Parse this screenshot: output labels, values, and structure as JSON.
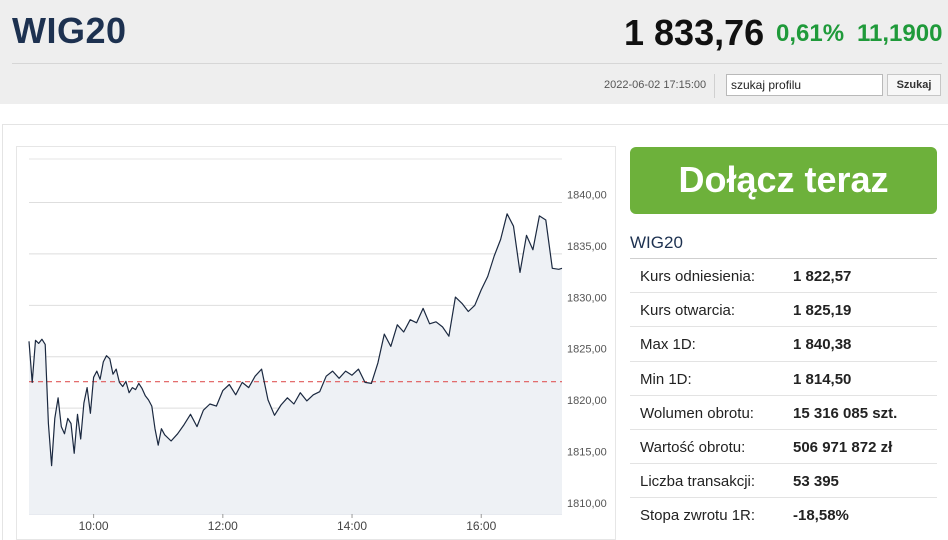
{
  "header": {
    "title": "WIG20",
    "price": "1 833,76",
    "change_pct": "0,61%",
    "change_abs": "11,1900",
    "timestamp": "2022-06-02 17:15:00",
    "search_placeholder": "szukaj profilu",
    "search_button": "Szukaj"
  },
  "colors": {
    "brand": "#1d3150",
    "positive": "#1f9a3a",
    "cta": "#6db13b",
    "line": "#1b2940",
    "reference": "#e05a5a"
  },
  "cta": {
    "label": "Dołącz teraz"
  },
  "panel": {
    "title": "WIG20",
    "rows": [
      {
        "label": "Kurs odniesienia:",
        "value": "1 822,57"
      },
      {
        "label": "Kurs otwarcia:",
        "value": "1 825,19"
      },
      {
        "label": "Max 1D:",
        "value": "1 840,38"
      },
      {
        "label": "Min 1D:",
        "value": "1 814,50"
      },
      {
        "label": "Wolumen obrotu:",
        "value": "15 316 085 szt."
      },
      {
        "label": "Wartość obrotu:",
        "value": "506 971 872 zł"
      },
      {
        "label": "Liczba transakcji:",
        "value": "53 395"
      },
      {
        "label": "Stopa zwrotu 1R:",
        "value": "-18,58%"
      }
    ]
  },
  "chart_data": {
    "type": "area",
    "title": "",
    "xlabel": "",
    "ylabel": "",
    "x_ticks": [
      "10:00",
      "12:00",
      "14:00",
      "16:00"
    ],
    "y_ticks": [
      "1810,00",
      "1815,00",
      "1820,00",
      "1825,00",
      "1830,00",
      "1835,00",
      "1840,00"
    ],
    "ylim": [
      1809.7,
      1845.4
    ],
    "xlim": [
      9.0,
      17.25
    ],
    "reference_value": 1822.57,
    "grid": true,
    "series": [
      {
        "x": [
          9.0,
          9.05,
          9.1,
          9.15,
          9.2,
          9.25,
          9.3,
          9.35,
          9.4,
          9.45,
          9.5,
          9.55,
          9.6,
          9.65,
          9.7,
          9.75,
          9.8,
          9.85,
          9.9,
          9.95,
          10.0,
          10.05,
          10.1,
          10.15,
          10.2,
          10.25,
          10.3,
          10.35,
          10.4,
          10.45,
          10.5,
          10.55,
          10.6,
          10.65,
          10.7,
          10.75,
          10.8,
          10.85,
          10.9,
          10.95,
          11.0,
          11.05,
          11.1,
          11.2,
          11.3,
          11.4,
          11.5,
          11.6,
          11.7,
          11.8,
          11.9,
          12.0,
          12.1,
          12.2,
          12.3,
          12.4,
          12.5,
          12.6,
          12.7,
          12.8,
          12.9,
          13.0,
          13.1,
          13.2,
          13.3,
          13.4,
          13.5,
          13.6,
          13.7,
          13.8,
          13.9,
          14.0,
          14.1,
          14.2,
          14.3,
          14.4,
          14.5,
          14.6,
          14.7,
          14.8,
          14.9,
          15.0,
          15.1,
          15.2,
          15.3,
          15.4,
          15.5,
          15.6,
          15.7,
          15.8,
          15.9,
          16.0,
          16.1,
          16.2,
          16.3,
          16.4,
          16.5,
          16.6,
          16.7,
          16.8,
          16.9,
          17.0,
          17.1,
          17.2,
          17.25
        ],
        "y": [
          1826.5,
          1822.5,
          1826.6,
          1826.3,
          1826.7,
          1826.2,
          1818.5,
          1814.4,
          1819.0,
          1821.0,
          1818.2,
          1817.5,
          1819.0,
          1818.5,
          1815.6,
          1819.4,
          1817.0,
          1820.5,
          1822.0,
          1819.5,
          1823.0,
          1823.6,
          1822.8,
          1824.5,
          1825.1,
          1824.8,
          1823.3,
          1823.8,
          1822.5,
          1822.1,
          1822.6,
          1821.5,
          1822.0,
          1821.8,
          1822.4,
          1821.9,
          1821.2,
          1820.8,
          1820.2,
          1818.0,
          1816.4,
          1818.0,
          1817.4,
          1816.8,
          1817.5,
          1818.4,
          1819.4,
          1818.2,
          1819.8,
          1820.4,
          1820.2,
          1821.7,
          1822.3,
          1821.3,
          1822.5,
          1822.0,
          1823.1,
          1823.8,
          1820.8,
          1819.3,
          1820.3,
          1821.0,
          1820.4,
          1821.5,
          1820.7,
          1821.3,
          1821.6,
          1823.1,
          1823.6,
          1822.9,
          1823.6,
          1823.2,
          1823.8,
          1822.5,
          1822.4,
          1824.4,
          1827.2,
          1826.0,
          1828.1,
          1827.4,
          1828.6,
          1828.3,
          1829.7,
          1828.2,
          1828.4,
          1827.9,
          1827.0,
          1830.8,
          1830.2,
          1829.4,
          1830.0,
          1831.5,
          1832.8,
          1834.8,
          1836.4,
          1838.9,
          1837.7,
          1833.2,
          1836.8,
          1835.4,
          1838.7,
          1838.3,
          1833.6,
          1833.5,
          1833.6
        ]
      }
    ]
  }
}
